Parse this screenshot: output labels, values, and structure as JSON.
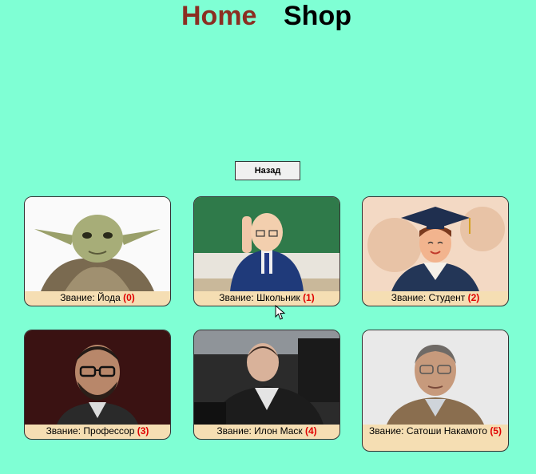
{
  "nav": {
    "home_label": "Home",
    "shop_label": "Shop",
    "home_color": "#8b2e22",
    "shop_color": "#000000"
  },
  "back_button": {
    "label": "Назад"
  },
  "cards": [
    {
      "caption": "Звание: Йода",
      "rank": "(0)",
      "image": "yoda-photo"
    },
    {
      "caption": "Звание: Школьник",
      "rank": "(1)",
      "image": "schoolboy-photo"
    },
    {
      "caption": "Звание: Студент",
      "rank": "(2)",
      "image": "graduate-student-illustration"
    },
    {
      "caption": "Звание: Профессор",
      "rank": "(3)",
      "image": "professor-photo"
    },
    {
      "caption": "Звание: Илон Маск",
      "rank": "(4)",
      "image": "elon-musk-photo"
    },
    {
      "caption": "Звание: Сатоши Накамото",
      "rank": "(5)",
      "image": "satoshi-nakamoto-photo"
    }
  ],
  "colors": {
    "background": "#7fffd4",
    "card_caption_bg": "#f5deb3",
    "rank_number": "#e00000"
  }
}
